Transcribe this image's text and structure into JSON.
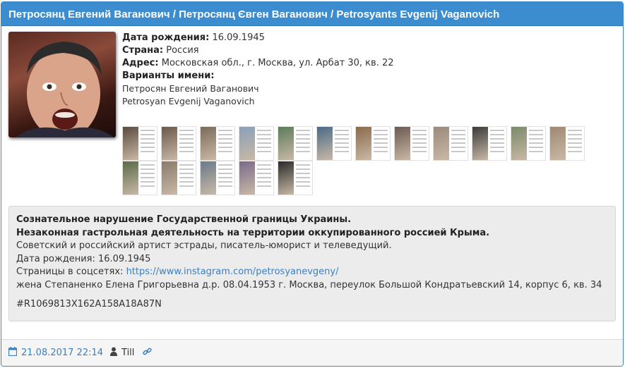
{
  "title": "Петросянц Евгений Ваганович / Петросянц Євген Ваганович / Petrosyants Evgenij Vaganovich",
  "avatar_icon": "person-photo",
  "info": {
    "birth_label": "Дата рождения:",
    "birth_value": "16.09.1945",
    "country_label": "Страна:",
    "country_value": "Россия",
    "address_label": "Адрес:",
    "address_value": "Московская обл., г. Москва, ул. Арбат 30, кв. 22",
    "variants_label": "Варианты имени:",
    "variants": [
      "Петросян Евгений Ваганович",
      "Petrosyan Evgenij Vaganovich"
    ]
  },
  "thumbnails": {
    "row1": [
      "photo-1",
      "photo-2",
      "photo-3",
      "photo-4",
      "photo-5",
      "photo-6",
      "photo-7",
      "photo-8",
      "photo-9",
      "photo-10",
      "photo-11",
      "photo-12"
    ],
    "row2": [
      "photo-13",
      "photo-14",
      "photo-15",
      "photo-16",
      "photo-17"
    ]
  },
  "description": {
    "line1": "Сознательное нарушение Государственной границы Украины.",
    "line2": "Незаконная гастрольная деятельность на территории оккупированного россией Крыма.",
    "line3": "Советский и российский артист эстрады, писатель-юморист и телеведущий.",
    "line4": "Дата рождения: 16.09.1945",
    "social_label": "Страницы в соцсетях: ",
    "social_link": "https://www.instagram.com/petrosyanevgeny/",
    "line6": "жена Степаненко Елена Григорьевна д.р. 08.04.1953 г. Москва, переулок Большой Кондратьевский 14, корпус 6, кв. 34",
    "tag": "#R1069813X162A158A18A87N"
  },
  "footer": {
    "date": "21.08.2017 22:14",
    "author": "Till",
    "icons": [
      "calendar-icon",
      "user-icon",
      "link-icon"
    ]
  },
  "colors": {
    "header": "#3c8dcf",
    "link": "#3c7fc0",
    "well": "#ececec"
  }
}
